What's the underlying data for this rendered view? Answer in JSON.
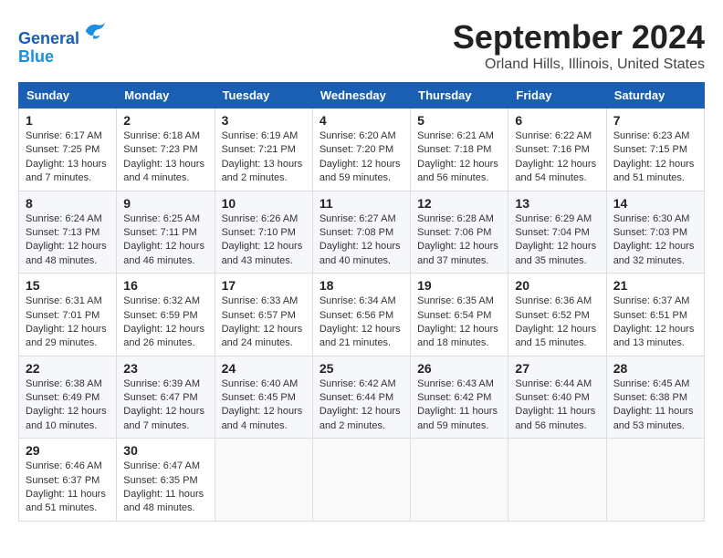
{
  "header": {
    "logo_line1": "General",
    "logo_line2": "Blue",
    "month_title": "September 2024",
    "location": "Orland Hills, Illinois, United States"
  },
  "weekdays": [
    "Sunday",
    "Monday",
    "Tuesday",
    "Wednesday",
    "Thursday",
    "Friday",
    "Saturday"
  ],
  "weeks": [
    [
      {
        "day": "1",
        "info": "Sunrise: 6:17 AM\nSunset: 7:25 PM\nDaylight: 13 hours\nand 7 minutes."
      },
      {
        "day": "2",
        "info": "Sunrise: 6:18 AM\nSunset: 7:23 PM\nDaylight: 13 hours\nand 4 minutes."
      },
      {
        "day": "3",
        "info": "Sunrise: 6:19 AM\nSunset: 7:21 PM\nDaylight: 13 hours\nand 2 minutes."
      },
      {
        "day": "4",
        "info": "Sunrise: 6:20 AM\nSunset: 7:20 PM\nDaylight: 12 hours\nand 59 minutes."
      },
      {
        "day": "5",
        "info": "Sunrise: 6:21 AM\nSunset: 7:18 PM\nDaylight: 12 hours\nand 56 minutes."
      },
      {
        "day": "6",
        "info": "Sunrise: 6:22 AM\nSunset: 7:16 PM\nDaylight: 12 hours\nand 54 minutes."
      },
      {
        "day": "7",
        "info": "Sunrise: 6:23 AM\nSunset: 7:15 PM\nDaylight: 12 hours\nand 51 minutes."
      }
    ],
    [
      {
        "day": "8",
        "info": "Sunrise: 6:24 AM\nSunset: 7:13 PM\nDaylight: 12 hours\nand 48 minutes."
      },
      {
        "day": "9",
        "info": "Sunrise: 6:25 AM\nSunset: 7:11 PM\nDaylight: 12 hours\nand 46 minutes."
      },
      {
        "day": "10",
        "info": "Sunrise: 6:26 AM\nSunset: 7:10 PM\nDaylight: 12 hours\nand 43 minutes."
      },
      {
        "day": "11",
        "info": "Sunrise: 6:27 AM\nSunset: 7:08 PM\nDaylight: 12 hours\nand 40 minutes."
      },
      {
        "day": "12",
        "info": "Sunrise: 6:28 AM\nSunset: 7:06 PM\nDaylight: 12 hours\nand 37 minutes."
      },
      {
        "day": "13",
        "info": "Sunrise: 6:29 AM\nSunset: 7:04 PM\nDaylight: 12 hours\nand 35 minutes."
      },
      {
        "day": "14",
        "info": "Sunrise: 6:30 AM\nSunset: 7:03 PM\nDaylight: 12 hours\nand 32 minutes."
      }
    ],
    [
      {
        "day": "15",
        "info": "Sunrise: 6:31 AM\nSunset: 7:01 PM\nDaylight: 12 hours\nand 29 minutes."
      },
      {
        "day": "16",
        "info": "Sunrise: 6:32 AM\nSunset: 6:59 PM\nDaylight: 12 hours\nand 26 minutes."
      },
      {
        "day": "17",
        "info": "Sunrise: 6:33 AM\nSunset: 6:57 PM\nDaylight: 12 hours\nand 24 minutes."
      },
      {
        "day": "18",
        "info": "Sunrise: 6:34 AM\nSunset: 6:56 PM\nDaylight: 12 hours\nand 21 minutes."
      },
      {
        "day": "19",
        "info": "Sunrise: 6:35 AM\nSunset: 6:54 PM\nDaylight: 12 hours\nand 18 minutes."
      },
      {
        "day": "20",
        "info": "Sunrise: 6:36 AM\nSunset: 6:52 PM\nDaylight: 12 hours\nand 15 minutes."
      },
      {
        "day": "21",
        "info": "Sunrise: 6:37 AM\nSunset: 6:51 PM\nDaylight: 12 hours\nand 13 minutes."
      }
    ],
    [
      {
        "day": "22",
        "info": "Sunrise: 6:38 AM\nSunset: 6:49 PM\nDaylight: 12 hours\nand 10 minutes."
      },
      {
        "day": "23",
        "info": "Sunrise: 6:39 AM\nSunset: 6:47 PM\nDaylight: 12 hours\nand 7 minutes."
      },
      {
        "day": "24",
        "info": "Sunrise: 6:40 AM\nSunset: 6:45 PM\nDaylight: 12 hours\nand 4 minutes."
      },
      {
        "day": "25",
        "info": "Sunrise: 6:42 AM\nSunset: 6:44 PM\nDaylight: 12 hours\nand 2 minutes."
      },
      {
        "day": "26",
        "info": "Sunrise: 6:43 AM\nSunset: 6:42 PM\nDaylight: 11 hours\nand 59 minutes."
      },
      {
        "day": "27",
        "info": "Sunrise: 6:44 AM\nSunset: 6:40 PM\nDaylight: 11 hours\nand 56 minutes."
      },
      {
        "day": "28",
        "info": "Sunrise: 6:45 AM\nSunset: 6:38 PM\nDaylight: 11 hours\nand 53 minutes."
      }
    ],
    [
      {
        "day": "29",
        "info": "Sunrise: 6:46 AM\nSunset: 6:37 PM\nDaylight: 11 hours\nand 51 minutes."
      },
      {
        "day": "30",
        "info": "Sunrise: 6:47 AM\nSunset: 6:35 PM\nDaylight: 11 hours\nand 48 minutes."
      },
      null,
      null,
      null,
      null,
      null
    ]
  ]
}
